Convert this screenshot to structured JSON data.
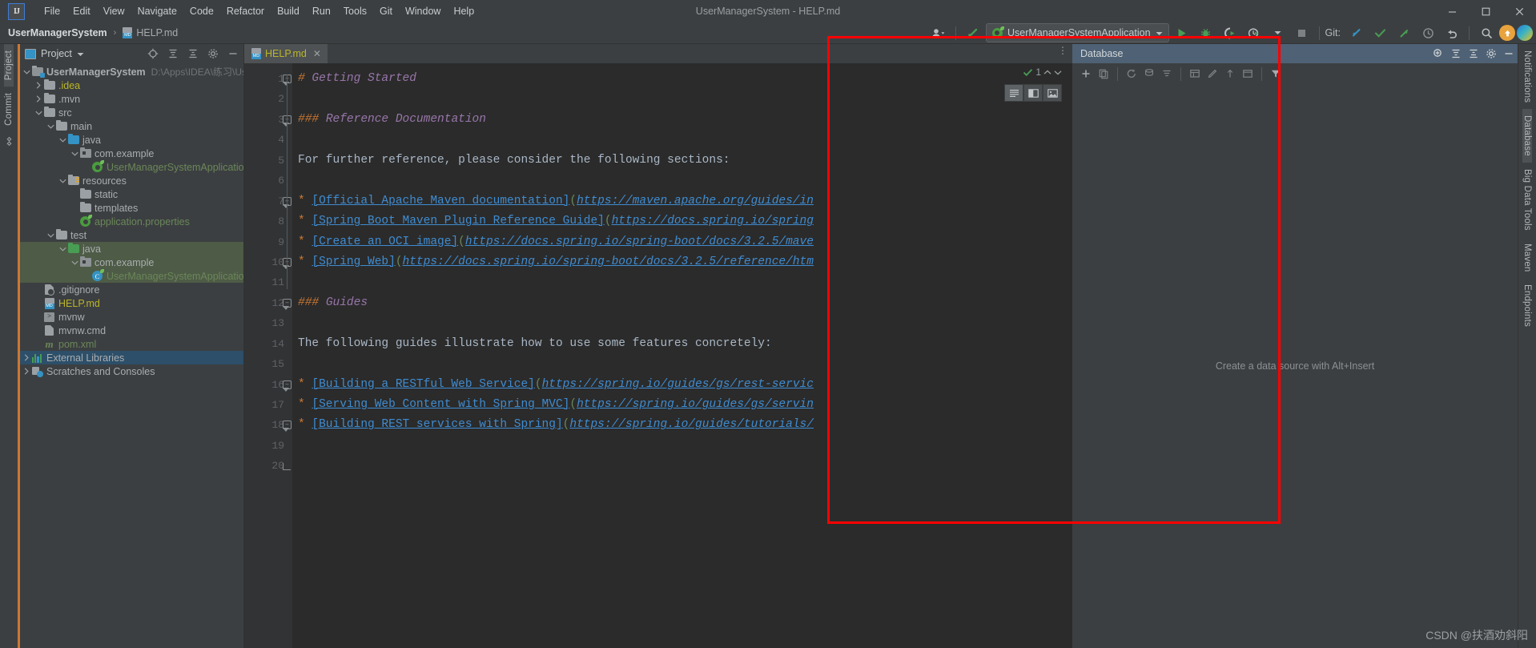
{
  "window": {
    "title": "UserManagerSystem - HELP.md",
    "logo": "IJ",
    "controls": {
      "minimize": "—",
      "maximize": "▢",
      "close": "✕"
    }
  },
  "menu": {
    "items": [
      "File",
      "Edit",
      "View",
      "Navigate",
      "Code",
      "Refactor",
      "Build",
      "Run",
      "Tools",
      "Git",
      "Window",
      "Help"
    ]
  },
  "breadcrumb": {
    "project": "UserManagerSystem",
    "separator": "›",
    "file": "HELP.md",
    "file_icon": "markdown-file-icon",
    "file_icon_tag": "MD"
  },
  "toolbar": {
    "account_icon": "user-account-icon",
    "updates_icon": "update-arrow-icon",
    "run_config": "UserManagerSystemApplication",
    "run_config_icon": "spring-boot-icon",
    "dropdown_icon": "chevron-down-icon",
    "run_icon": "run-triangle-icon",
    "debug_icon": "debug-bug-icon",
    "run_coverage_icon": "run-with-coverage-icon",
    "profiler_icon": "profiler-clock-icon",
    "stop_icon": "stop-square-icon",
    "git_label": "Git:",
    "git_update_icon": "update-project-arrow-icon",
    "git_commit_icon": "commit-check-icon",
    "git_push_icon": "push-arrow-icon",
    "git_history_icon": "history-clock-icon",
    "git_rollback_icon": "rollback-undo-icon",
    "search_icon": "search-magnifier-icon",
    "notification_icon": "orange-update-badge-icon",
    "ide_icon": "ide-feature-trainer-icon"
  },
  "left_rail": {
    "items": [
      {
        "label": "Project",
        "name": "tool-window-project",
        "selected": true
      },
      {
        "label": "Commit",
        "name": "tool-window-commit",
        "selected": false
      }
    ],
    "bottom_icon": "structure-icon"
  },
  "right_rail": {
    "items": [
      {
        "label": "Notifications",
        "name": "tool-window-notifications"
      },
      {
        "label": "Database",
        "name": "tool-window-database"
      },
      {
        "label": "Big Data Tools",
        "name": "tool-window-big-data-tools"
      },
      {
        "label": "Maven",
        "name": "tool-window-maven"
      },
      {
        "label": "Endpoints",
        "name": "tool-window-endpoints"
      }
    ]
  },
  "project_panel": {
    "title": "Project",
    "title_dropdown": "chevron-down-icon",
    "actions": [
      "locate-target-icon",
      "expand-all-icon",
      "collapse-all-icon",
      "settings-gear-icon",
      "hide-minus-icon"
    ],
    "tree": [
      {
        "indent": 0,
        "arrow": "down",
        "icon": "project-module-icon",
        "label": "UserManagerSystem",
        "color": "grey",
        "bold": true,
        "path": "D:\\Apps\\IDEA\\练习\\UserMana",
        "state": "normal"
      },
      {
        "indent": 1,
        "arrow": "right",
        "icon": "folder-icon",
        "label": ".idea",
        "color": "yellow",
        "state": "normal"
      },
      {
        "indent": 1,
        "arrow": "right",
        "icon": "folder-icon",
        "label": ".mvn",
        "color": "grey",
        "state": "normal"
      },
      {
        "indent": 1,
        "arrow": "down",
        "icon": "folder-icon",
        "label": "src",
        "color": "grey",
        "state": "normal"
      },
      {
        "indent": 2,
        "arrow": "down",
        "icon": "folder-icon",
        "label": "main",
        "color": "grey",
        "state": "normal"
      },
      {
        "indent": 3,
        "arrow": "down",
        "icon": "folder-source-icon",
        "label": "java",
        "color": "grey",
        "state": "normal"
      },
      {
        "indent": 4,
        "arrow": "down",
        "icon": "package-icon",
        "label": "com.example",
        "color": "grey",
        "state": "normal"
      },
      {
        "indent": 5,
        "arrow": "none",
        "icon": "spring-boot-class-icon",
        "label": "UserManagerSystemApplication",
        "color": "green",
        "state": "normal"
      },
      {
        "indent": 3,
        "arrow": "down",
        "icon": "folder-resources-icon",
        "label": "resources",
        "color": "grey",
        "state": "normal"
      },
      {
        "indent": 4,
        "arrow": "none",
        "icon": "folder-icon",
        "label": "static",
        "color": "grey",
        "state": "normal"
      },
      {
        "indent": 4,
        "arrow": "none",
        "icon": "folder-icon",
        "label": "templates",
        "color": "grey",
        "state": "normal"
      },
      {
        "indent": 4,
        "arrow": "none",
        "icon": "spring-properties-icon",
        "label": "application.properties",
        "color": "green",
        "state": "normal"
      },
      {
        "indent": 2,
        "arrow": "down",
        "icon": "folder-icon",
        "label": "test",
        "color": "grey",
        "state": "normal"
      },
      {
        "indent": 3,
        "arrow": "down",
        "icon": "folder-test-source-icon",
        "label": "java",
        "color": "grey",
        "state": "selected-green"
      },
      {
        "indent": 4,
        "arrow": "down",
        "icon": "package-icon",
        "label": "com.example",
        "color": "grey",
        "state": "selected-green"
      },
      {
        "indent": 5,
        "arrow": "none",
        "icon": "test-class-icon",
        "label": "UserManagerSystemApplicationTests",
        "color": "green",
        "state": "selected-green"
      },
      {
        "indent": 1,
        "arrow": "none",
        "icon": "gitignore-file-icon",
        "label": ".gitignore",
        "color": "grey",
        "state": "normal"
      },
      {
        "indent": 1,
        "arrow": "none",
        "icon": "markdown-file-icon",
        "label": "HELP.md",
        "color": "yellow",
        "state": "normal"
      },
      {
        "indent": 1,
        "arrow": "none",
        "icon": "shell-script-icon",
        "label": "mvnw",
        "color": "grey",
        "state": "normal"
      },
      {
        "indent": 1,
        "arrow": "none",
        "icon": "cmd-file-icon",
        "label": "mvnw.cmd",
        "color": "grey",
        "state": "normal"
      },
      {
        "indent": 1,
        "arrow": "none",
        "icon": "maven-pom-icon",
        "label": "pom.xml",
        "color": "green",
        "state": "normal"
      },
      {
        "indent": 0,
        "arrow": "right",
        "icon": "external-libraries-icon",
        "label": "External Libraries",
        "color": "grey",
        "state": "selected-blue"
      },
      {
        "indent": 0,
        "arrow": "right",
        "icon": "scratches-icon",
        "label": "Scratches and Consoles",
        "color": "grey",
        "state": "normal"
      }
    ]
  },
  "editor": {
    "tab": {
      "label": "HELP.md",
      "icon": "markdown-file-icon",
      "icon_tag": "MD",
      "close_icon": "close-x-icon"
    },
    "inspection": {
      "count": "1",
      "ok_icon": "inspection-check-icon",
      "up_icon": "chevron-up-icon",
      "down_icon": "chevron-down-icon"
    },
    "view_modes": [
      {
        "name": "editor-only-mode",
        "icon": "lines-icon",
        "active": true
      },
      {
        "name": "split-mode",
        "icon": "split-pane-icon",
        "active": false
      },
      {
        "name": "preview-only-mode",
        "icon": "preview-image-icon",
        "active": false
      }
    ],
    "line_numbers": [
      "1",
      "2",
      "3",
      "4",
      "5",
      "6",
      "7",
      "8",
      "9",
      "10",
      "11",
      "12",
      "13",
      "14",
      "15",
      "16",
      "17",
      "18",
      "19",
      "20"
    ],
    "lines": [
      {
        "n": 1,
        "fold": "start",
        "segments": [
          {
            "t": "# ",
            "c": "hash"
          },
          {
            "t": "Getting Started",
            "c": "head"
          }
        ]
      },
      {
        "n": 2,
        "fold": "none",
        "segments": []
      },
      {
        "n": 3,
        "fold": "start",
        "segments": [
          {
            "t": "### ",
            "c": "hash"
          },
          {
            "t": "Reference Documentation",
            "c": "head"
          }
        ]
      },
      {
        "n": 4,
        "fold": "none",
        "segments": []
      },
      {
        "n": 5,
        "fold": "none",
        "segments": [
          {
            "t": "For further reference, please consider the following sections:",
            "c": "plain"
          }
        ]
      },
      {
        "n": 6,
        "fold": "none",
        "segments": []
      },
      {
        "n": 7,
        "fold": "start",
        "segments": [
          {
            "t": "* ",
            "c": "bullet"
          },
          {
            "t": "[Official Apache Maven documentation]",
            "c": "link"
          },
          {
            "t": "(",
            "c": "paren"
          },
          {
            "t": "https://maven.apache.org/guides/in",
            "c": "url"
          }
        ]
      },
      {
        "n": 8,
        "fold": "none",
        "segments": [
          {
            "t": "* ",
            "c": "bullet"
          },
          {
            "t": "[Spring Boot Maven Plugin Reference Guide]",
            "c": "link"
          },
          {
            "t": "(",
            "c": "paren"
          },
          {
            "t": "https://docs.spring.io/spring",
            "c": "url"
          }
        ]
      },
      {
        "n": 9,
        "fold": "none",
        "segments": [
          {
            "t": "* ",
            "c": "bullet"
          },
          {
            "t": "[Create an OCI image]",
            "c": "link"
          },
          {
            "t": "(",
            "c": "paren"
          },
          {
            "t": "https://docs.spring.io/spring-boot/docs/3.2.5/mave",
            "c": "url"
          }
        ]
      },
      {
        "n": 10,
        "fold": "start",
        "segments": [
          {
            "t": "* ",
            "c": "bullet"
          },
          {
            "t": "[Spring Web]",
            "c": "link"
          },
          {
            "t": "(",
            "c": "paren"
          },
          {
            "t": "https://docs.spring.io/spring-boot/docs/3.2.5/reference/htm",
            "c": "url"
          }
        ]
      },
      {
        "n": 11,
        "fold": "none",
        "segments": []
      },
      {
        "n": 12,
        "fold": "start",
        "segments": [
          {
            "t": "### ",
            "c": "hash"
          },
          {
            "t": "Guides",
            "c": "head"
          }
        ]
      },
      {
        "n": 13,
        "fold": "none",
        "segments": []
      },
      {
        "n": 14,
        "fold": "none",
        "segments": [
          {
            "t": "The following guides illustrate how to use some features concretely:",
            "c": "plain"
          }
        ]
      },
      {
        "n": 15,
        "fold": "none",
        "segments": []
      },
      {
        "n": 16,
        "fold": "start",
        "segments": [
          {
            "t": "* ",
            "c": "bullet"
          },
          {
            "t": "[Building a RESTful Web Service]",
            "c": "link"
          },
          {
            "t": "(",
            "c": "paren"
          },
          {
            "t": "https://spring.io/guides/gs/rest-servic",
            "c": "url"
          }
        ]
      },
      {
        "n": 17,
        "fold": "none",
        "segments": [
          {
            "t": "* ",
            "c": "bullet"
          },
          {
            "t": "[Serving Web Content with Spring MVC]",
            "c": "link"
          },
          {
            "t": "(",
            "c": "paren"
          },
          {
            "t": "https://spring.io/guides/gs/servin",
            "c": "url"
          }
        ]
      },
      {
        "n": 18,
        "fold": "start",
        "segments": [
          {
            "t": "* ",
            "c": "bullet"
          },
          {
            "t": "[Building REST services with Spring]",
            "c": "link"
          },
          {
            "t": "(",
            "c": "paren"
          },
          {
            "t": "https://spring.io/guides/tutorials/",
            "c": "url"
          }
        ]
      },
      {
        "n": 19,
        "fold": "none",
        "segments": []
      },
      {
        "n": 20,
        "fold": "end",
        "segments": []
      }
    ]
  },
  "database_panel": {
    "title": "Database",
    "header_actions": [
      "add-data-source-icon",
      "expand-icon",
      "collapse-icon",
      "settings-gear-icon",
      "hide-minus-icon"
    ],
    "toolbar_actions": [
      "add-plus-icon",
      "duplicate-icon",
      "refresh-icon",
      "sync-database-icon",
      "filter-schema-icon",
      "table-editor-icon",
      "modify-icon",
      "jump-to-icon",
      "console-icon",
      "filter-funnel-icon"
    ],
    "empty_message": "Create a data source with Alt+Insert"
  },
  "watermark": "CSDN @扶酒劝斜阳",
  "colors": {
    "accent_blue": "#3592c4",
    "green": "#499c54",
    "orange": "#cc7832",
    "yellow": "#bbb529",
    "link": "#3f8cd1",
    "panel_bg": "#3c3f41",
    "editor_bg": "#2b2b2b",
    "db_header": "#4e6175",
    "red_highlight": "#ff0000"
  }
}
